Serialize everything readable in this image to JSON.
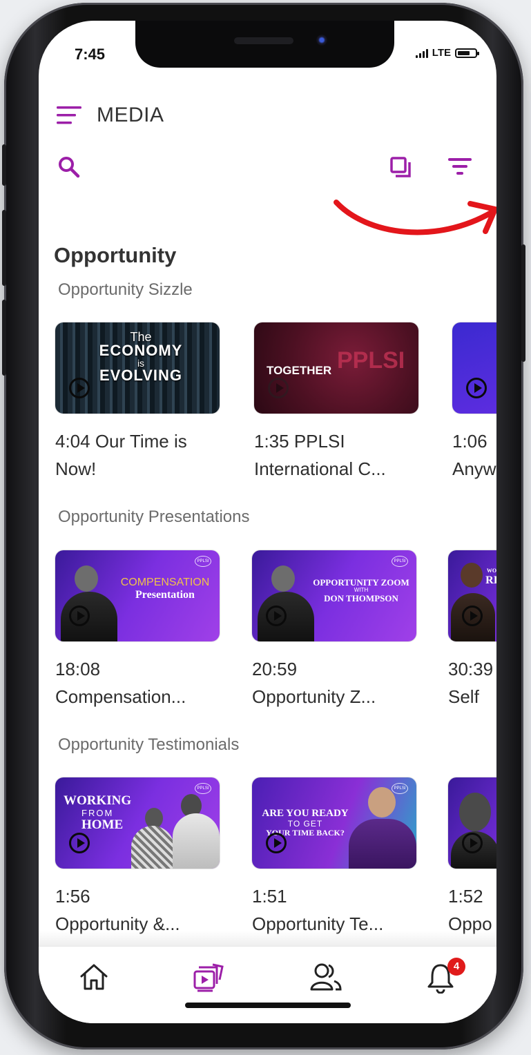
{
  "status_bar": {
    "time": "7:45",
    "network": "LTE"
  },
  "header": {
    "title": "MEDIA"
  },
  "section": {
    "title": "Opportunity"
  },
  "rows": [
    {
      "title": "Opportunity Sizzle",
      "cards": [
        {
          "line1": "4:04 Our Time is",
          "line2": "Now!",
          "thumb_text": [
            "The",
            "ECONOMY",
            "is",
            "EVOLVING"
          ]
        },
        {
          "line1": "1:35 PPLSI",
          "line2": "International C...",
          "thumb_text": [
            "TOGETHER",
            "PPLSI"
          ]
        },
        {
          "line1": "1:06",
          "line2": "Anyw"
        }
      ]
    },
    {
      "title": "Opportunity Presentations",
      "cards": [
        {
          "line1": "18:08",
          "line2": "Compensation...",
          "thumb_text": [
            "COMPENSATION",
            "Presentation"
          ]
        },
        {
          "line1": "20:59",
          "line2": "Opportunity Z...",
          "thumb_text": [
            "OPPORTUNITY ZOOM",
            "WITH",
            "DON THOMPSON"
          ]
        },
        {
          "line1": "30:39",
          "line2": "Self",
          "thumb_text": [
            "WO",
            "RI"
          ]
        }
      ]
    },
    {
      "title": "Opportunity Testimonials",
      "cards": [
        {
          "line1": "1:56",
          "line2": "Opportunity &...",
          "thumb_text": [
            "WORKING",
            "FROM",
            "HOME"
          ]
        },
        {
          "line1": "1:51",
          "line2": "Opportunity Te...",
          "thumb_text": [
            "ARE YOU READY",
            "TO GET",
            "YOUR TIME BACK?"
          ]
        },
        {
          "line1": "1:52",
          "line2": "Oppo"
        }
      ]
    }
  ],
  "logo_text": "PPLSI",
  "tabbar": {
    "notification_count": "4",
    "active_tab": "media"
  },
  "colors": {
    "accent": "#9c1fa8",
    "badge": "#e01b1b",
    "annotation_arrow": "#e3161b"
  }
}
